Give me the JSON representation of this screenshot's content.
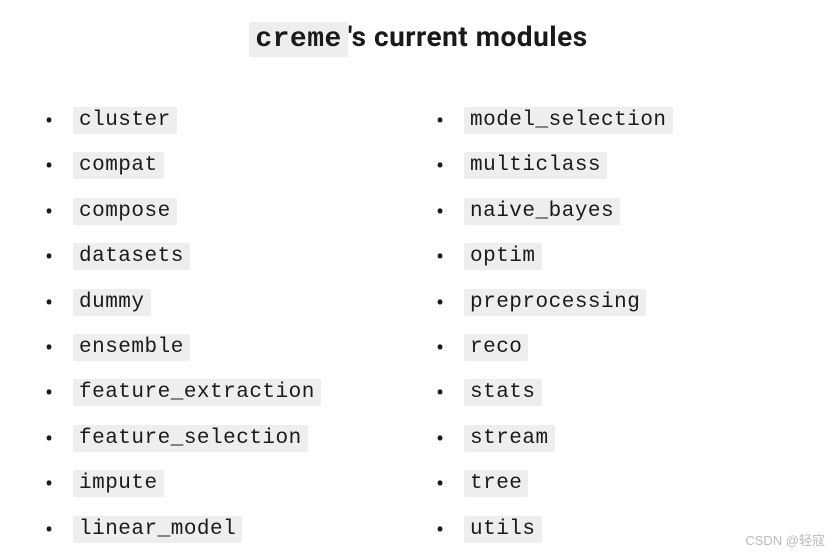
{
  "heading": {
    "code": "creme",
    "suffix": "'s current modules"
  },
  "columns": {
    "left": [
      "cluster",
      "compat",
      "compose",
      "datasets",
      "dummy",
      "ensemble",
      "feature_extraction",
      "feature_selection",
      "impute",
      "linear_model"
    ],
    "right": [
      "model_selection",
      "multiclass",
      "naive_bayes",
      "optim",
      "preprocessing",
      "reco",
      "stats",
      "stream",
      "tree",
      "utils"
    ]
  },
  "watermark": "CSDN @轻寇"
}
